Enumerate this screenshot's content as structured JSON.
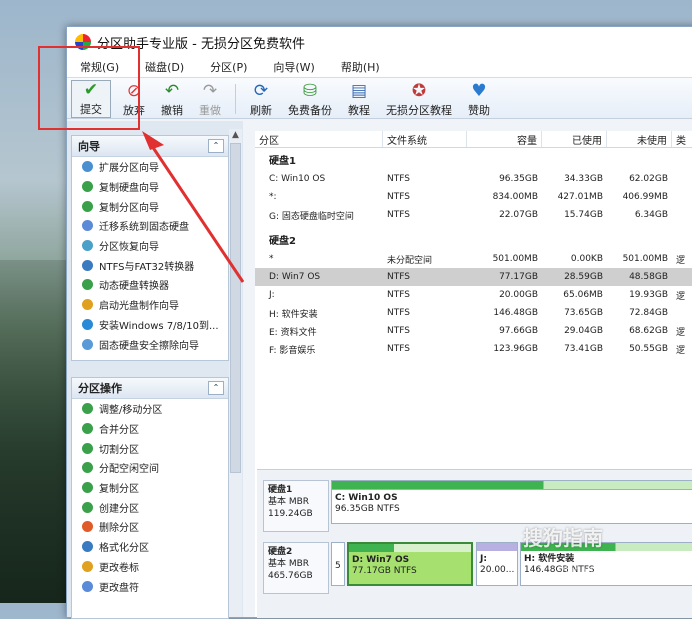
{
  "window": {
    "title": "分区助手专业版 - 无损分区免费软件"
  },
  "menu": [
    "常规(G)",
    "磁盘(D)",
    "分区(P)",
    "向导(W)",
    "帮助(H)"
  ],
  "toolbar": {
    "submit": "提交",
    "discard": "放弃",
    "undo": "撤销",
    "redo": "重做",
    "refresh": "刷新",
    "backup": "免费备份",
    "tutorial": "教程",
    "lossless": "无损分区教程",
    "donate": "赞助"
  },
  "wizard": {
    "title": "向导",
    "items": [
      "扩展分区向导",
      "复制硬盘向导",
      "复制分区向导",
      "迁移系统到固态硬盘",
      "分区恢复向导",
      "NTFS与FAT32转换器",
      "动态硬盘转换器",
      "启动光盘制作向导",
      "安装Windows 7/8/10到...",
      "固态硬盘安全擦除向导"
    ]
  },
  "partops": {
    "title": "分区操作",
    "items": [
      "调整/移动分区",
      "合并分区",
      "切割分区",
      "分配空闲空间",
      "复制分区",
      "创建分区",
      "删除分区",
      "格式化分区",
      "更改卷标",
      "更改盘符"
    ]
  },
  "table": {
    "headers": [
      "分区",
      "文件系统",
      "容量",
      "已使用",
      "未使用",
      "类"
    ],
    "disk1_label": "硬盘1",
    "disk1": [
      [
        "C: Win10 OS",
        "NTFS",
        "96.35GB",
        "34.33GB",
        "62.02GB",
        ""
      ],
      [
        "*:",
        "NTFS",
        "834.00MB",
        "427.01MB",
        "406.99MB",
        ""
      ],
      [
        "G: 固态硬盘临时空间",
        "NTFS",
        "22.07GB",
        "15.74GB",
        "6.34GB",
        ""
      ]
    ],
    "disk2_label": "硬盘2",
    "disk2": [
      [
        "*",
        "未分配空间",
        "501.00MB",
        "0.00KB",
        "501.00MB",
        "逻"
      ],
      [
        "D: Win7 OS",
        "NTFS",
        "77.17GB",
        "28.59GB",
        "48.58GB",
        ""
      ],
      [
        "J:",
        "NTFS",
        "20.00GB",
        "65.06MB",
        "19.93GB",
        "逻"
      ],
      [
        "H: 软件安装",
        "NTFS",
        "146.48GB",
        "73.65GB",
        "72.84GB",
        ""
      ],
      [
        "E: 资料文件",
        "NTFS",
        "97.66GB",
        "29.04GB",
        "68.62GB",
        "逻"
      ],
      [
        "F: 影音娱乐",
        "NTFS",
        "123.96GB",
        "73.41GB",
        "50.55GB",
        "逻"
      ]
    ]
  },
  "diskmap": {
    "d1": {
      "name": "硬盘1",
      "type": "基本 MBR",
      "size": "119.24GB",
      "p1_name": "C: Win10 OS",
      "p1_info": "96.35GB NTFS"
    },
    "d2": {
      "name": "硬盘2",
      "type": "基本 MBR",
      "size": "465.76GB",
      "p0": "5",
      "p1_name": "D: Win7 OS",
      "p1_info": "77.17GB NTFS",
      "p2_name": "J:",
      "p2_info": "20.00...",
      "p3_name": "H: 软件安装",
      "p3_info": "146.48GB NTFS"
    }
  },
  "watermark": {
    "text": "搜狗指南",
    "sub": "zhinan.sogou.com"
  },
  "colors": {
    "accent_red": "#e03030",
    "used_bar": "#3fb34f",
    "free_part": "#a6e06e",
    "selected_row": "#cfcfcf"
  }
}
